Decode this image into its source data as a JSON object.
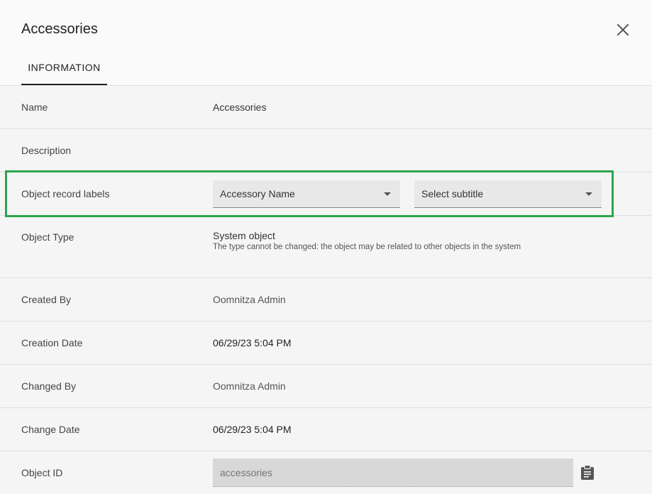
{
  "dialog": {
    "title": "Accessories",
    "tabs": [
      {
        "label": "INFORMATION",
        "active": true
      }
    ]
  },
  "fields": {
    "name": {
      "label": "Name",
      "value": "Accessories"
    },
    "description": {
      "label": "Description",
      "value": ""
    },
    "record_labels": {
      "label": "Object record labels",
      "title_select": "Accessory Name",
      "subtitle_select": "Select subtitle"
    },
    "object_type": {
      "label": "Object Type",
      "value": "System object",
      "hint": "The type cannot be changed: the object may be related to other objects in the system"
    },
    "created_by": {
      "label": "Created By",
      "value": "Oomnitza Admin"
    },
    "creation_date": {
      "label": "Creation Date",
      "value": "06/29/23 5:04 PM"
    },
    "changed_by": {
      "label": "Changed By",
      "value": "Oomnitza Admin"
    },
    "change_date": {
      "label": "Change Date",
      "value": "06/29/23 5:04 PM"
    },
    "object_id": {
      "label": "Object ID",
      "placeholder": "accessories"
    }
  },
  "colors": {
    "highlight": "#2ea44f",
    "tab_indicator": "#222222"
  },
  "icons": {
    "close": "close-icon",
    "dropdown": "chevron-down-icon",
    "copy": "clipboard-icon"
  }
}
